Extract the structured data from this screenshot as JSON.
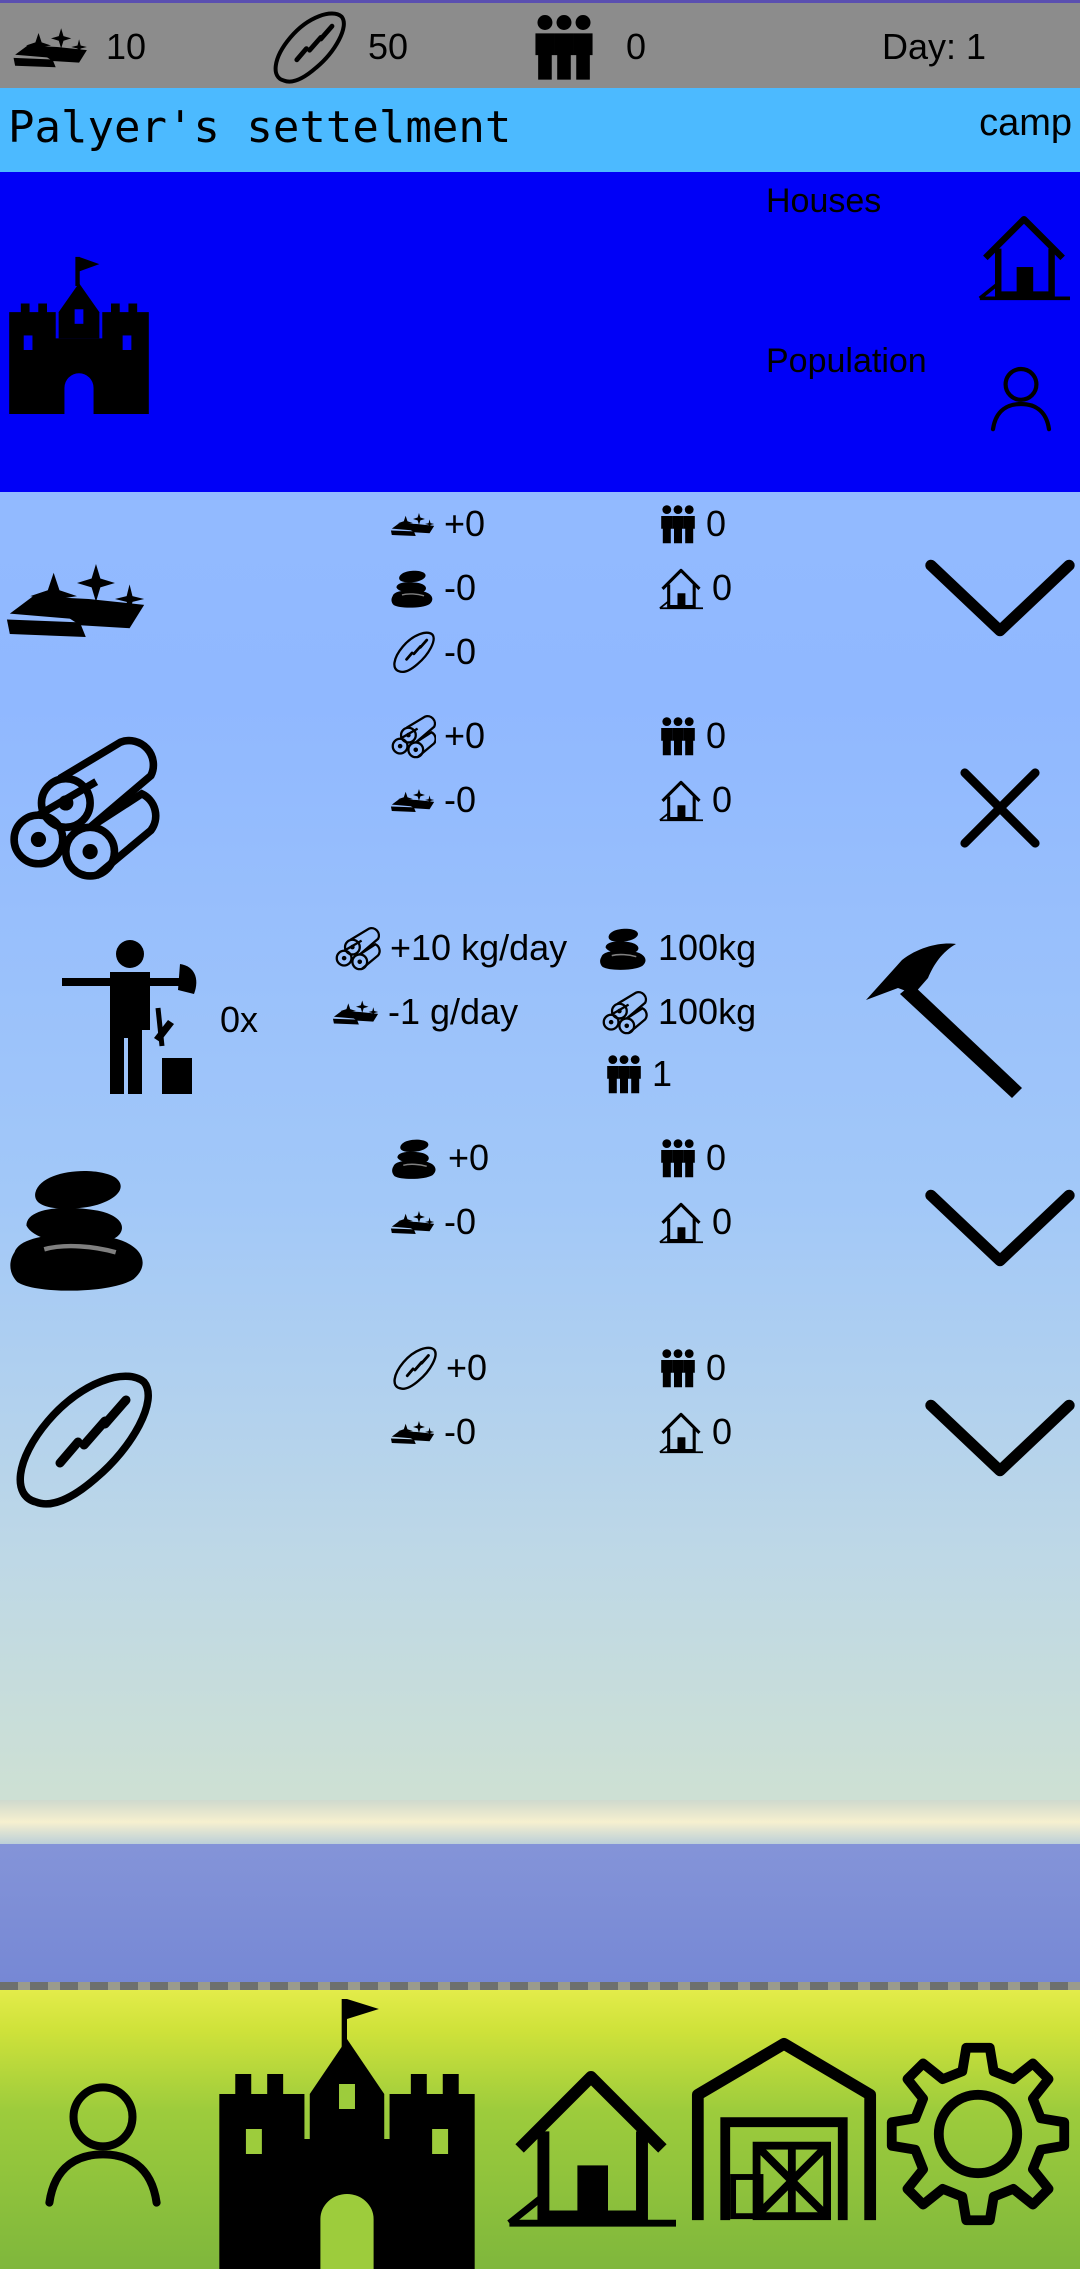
{
  "topbar": {
    "gold": "10",
    "food": "50",
    "population": "0",
    "day": "Day: 1"
  },
  "header": {
    "title": "Palyer's settelment",
    "type": "camp"
  },
  "panel": {
    "houses_label": "Houses",
    "population_label": "Population",
    "background_color": "#0000f7"
  },
  "rows": [
    {
      "name": "gold",
      "icon": "gold-bars-icon",
      "stats": [
        "+0",
        "-0",
        "-0"
      ],
      "workers": "0",
      "houses": "0",
      "action": "chevron-down-icon"
    },
    {
      "name": "wood",
      "icon": "logs-icon",
      "stats": [
        "+0",
        "-0"
      ],
      "workers": "0",
      "houses": "0",
      "action": "close-icon"
    },
    {
      "name": "lumberjack",
      "icon": "lumberjack-icon",
      "count": "0x",
      "produce": "+10 kg/day",
      "cost": "-1 g/day",
      "req_stone": "100kg",
      "req_wood": "100kg",
      "req_workers": "1",
      "action": "hammer-icon"
    },
    {
      "name": "stone",
      "icon": "stones-icon",
      "stats": [
        "+0",
        "-0"
      ],
      "workers": "0",
      "houses": "0",
      "action": "chevron-down-icon"
    },
    {
      "name": "bread",
      "icon": "bread-icon",
      "stats": [
        "+0",
        "-0"
      ],
      "workers": "0",
      "houses": "0",
      "action": "chevron-down-icon"
    }
  ],
  "bottom_nav": [
    "person-icon",
    "castle-icon",
    "house-icon",
    "barn-icon",
    "gear-icon"
  ]
}
